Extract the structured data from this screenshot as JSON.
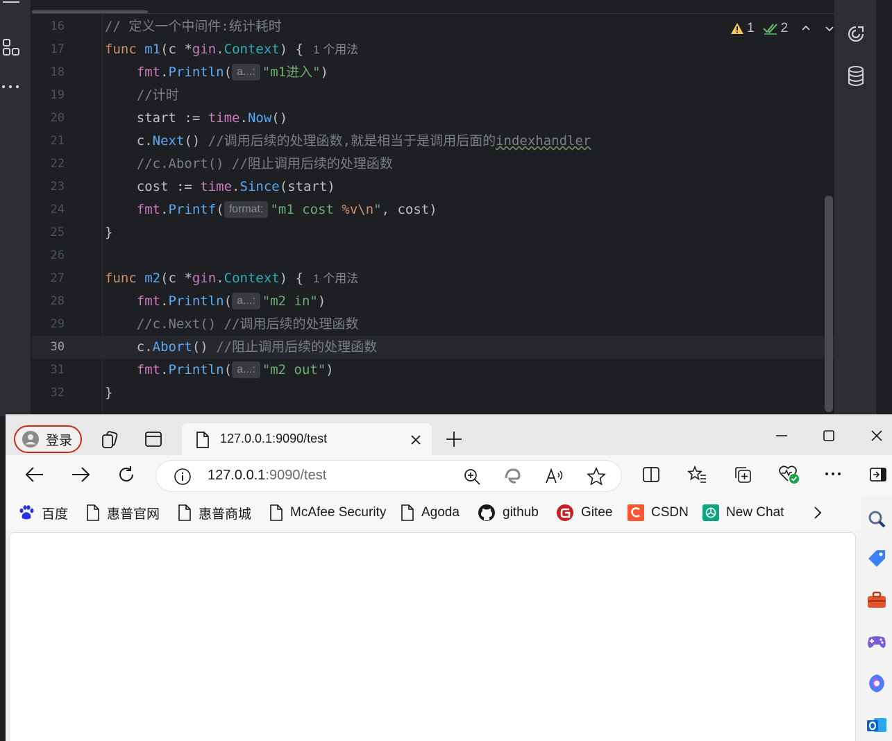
{
  "editor": {
    "lines": [
      {
        "num": "16"
      },
      {
        "num": "17"
      },
      {
        "num": "18"
      },
      {
        "num": "19"
      },
      {
        "num": "20"
      },
      {
        "num": "21"
      },
      {
        "num": "22"
      },
      {
        "num": "23"
      },
      {
        "num": "24"
      },
      {
        "num": "25"
      },
      {
        "num": "26"
      },
      {
        "num": "27"
      },
      {
        "num": "28"
      },
      {
        "num": "29"
      },
      {
        "num": "30"
      },
      {
        "num": "31"
      },
      {
        "num": "32"
      }
    ],
    "code": {
      "l16_comment": "// 定义一个中间件:统计耗时",
      "kw_func": "func",
      "m1_name": "m1",
      "paren_c": "(c ",
      "star": "*",
      "pkg_gin": "gin",
      "dot": ".",
      "type_context": "Context",
      "brace_open": ") {",
      "usage": "1 个用法",
      "fmt": "fmt",
      "println": "Println",
      "paren_open": "(",
      "hint_a": "a...:",
      "str_m1_in": "\"m1进入\"",
      "paren_close": ")",
      "l19_comment": "//计时",
      "start_assign": "start := ",
      "time": "time",
      "now": "Now",
      "empty_call": "()",
      "c_dot": "c.",
      "next": "Next",
      "l21_comment": "//调用后续的处理函数,就是相当于是调用后面的",
      "l21_underlined": "indexhandler",
      "l22_comment": "//c.Abort() //阻止调用后续的处理函数",
      "cost_assign": "cost := ",
      "since": "Since",
      "since_args": "(start)",
      "printf": "Printf",
      "hint_format": "format:",
      "str_m1_cost_a": "\"m1 cost ",
      "str_m1_cost_esc": "%v\\n",
      "str_m1_cost_b": "\"",
      "cost_tail": ", cost)",
      "brace_close": "}",
      "m2_name": "m2",
      "str_m2_in": "\"m2 in\"",
      "l29_comment": "//c.Next() //调用后续的处理函数",
      "abort": "Abort",
      "l30_comment": "//阻止调用后续的处理函数",
      "str_m2_out": "\"m2 out\""
    },
    "inspections": {
      "warnings": "1",
      "ok": "2"
    }
  },
  "browser": {
    "profile_label": "登录",
    "tab_title": "127.0.0.1:9090/test",
    "url_host": "127.0.0.1",
    "url_rest": ":9090/test",
    "favorites": [
      {
        "label": "百度"
      },
      {
        "label": "惠普官网"
      },
      {
        "label": "惠普商城"
      },
      {
        "label": "McAfee Security"
      },
      {
        "label": "Agoda"
      },
      {
        "label": "github"
      },
      {
        "label": "Gitee"
      },
      {
        "label": "CSDN"
      },
      {
        "label": "New Chat"
      }
    ]
  },
  "colors": {
    "editor_bg": "#1e1f22",
    "keyword": "#cf8e6d",
    "function": "#56a8f5",
    "package": "#c77dbb",
    "type": "#2aacb8",
    "string": "#6aab73",
    "comment": "#7a7e85",
    "gitee_red": "#c71d23",
    "csdn_orange": "#fc5531",
    "chat_green": "#10a37f",
    "baidu_blue": "#2932e1"
  }
}
